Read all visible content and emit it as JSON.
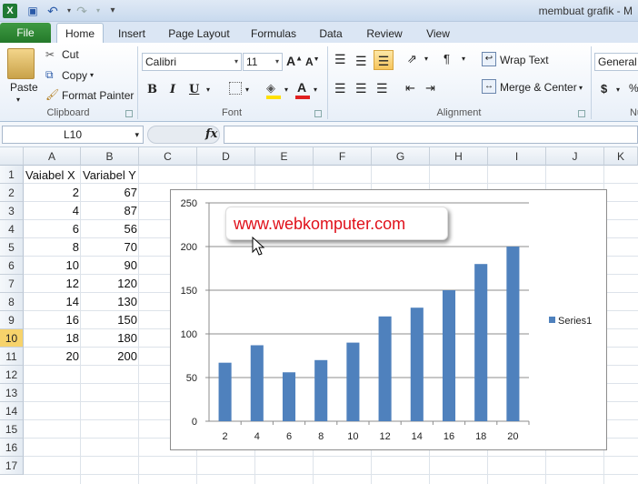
{
  "window": {
    "title": "membuat grafik - M"
  },
  "tabs": {
    "file": "File",
    "items": [
      "Home",
      "Insert",
      "Page Layout",
      "Formulas",
      "Data",
      "Review",
      "View"
    ]
  },
  "ribbon": {
    "clipboard": {
      "paste": "Paste",
      "cut": "Cut",
      "copy": "Copy",
      "format_painter": "Format Painter",
      "label": "Clipboard"
    },
    "font": {
      "name": "Calibri",
      "size": "11",
      "label": "Font",
      "bold": "B",
      "italic": "I",
      "underline": "U",
      "font_color": "#e02020",
      "fill_color": "#ffe000"
    },
    "alignment": {
      "wrap": "Wrap Text",
      "merge": "Merge & Center",
      "label": "Alignment"
    },
    "number": {
      "format": "General",
      "currency": "$",
      "percent": "%",
      "label": "Nu"
    }
  },
  "formula_bar": {
    "name_box": "L10",
    "fx": "fx",
    "value": ""
  },
  "sheet": {
    "columns": [
      "A",
      "B",
      "C",
      "D",
      "E",
      "F",
      "G",
      "H",
      "I",
      "J",
      "K"
    ],
    "rows": [
      "1",
      "2",
      "3",
      "4",
      "5",
      "6",
      "7",
      "8",
      "9",
      "10",
      "11",
      "12",
      "13",
      "14",
      "15",
      "16",
      "17"
    ],
    "selected_row": "10",
    "header_a": "Vaiabel X",
    "header_b": "Variabel Y",
    "x_values": [
      "2",
      "4",
      "6",
      "8",
      "10",
      "12",
      "14",
      "16",
      "18",
      "20"
    ],
    "y_values": [
      "67",
      "87",
      "56",
      "70",
      "90",
      "120",
      "130",
      "150",
      "180",
      "200"
    ]
  },
  "callout": {
    "text": "www.webkomputer.com"
  },
  "chart_data": {
    "type": "bar",
    "categories": [
      "2",
      "4",
      "6",
      "8",
      "10",
      "12",
      "14",
      "16",
      "18",
      "20"
    ],
    "series": [
      {
        "name": "Series1",
        "values": [
          67,
          87,
          56,
          70,
          90,
          120,
          130,
          150,
          180,
          200
        ],
        "color": "#4f81bd"
      }
    ],
    "ylim": [
      0,
      250
    ],
    "yticks": [
      "0",
      "50",
      "100",
      "150",
      "200",
      "250"
    ],
    "grid": true,
    "legend": "right"
  }
}
